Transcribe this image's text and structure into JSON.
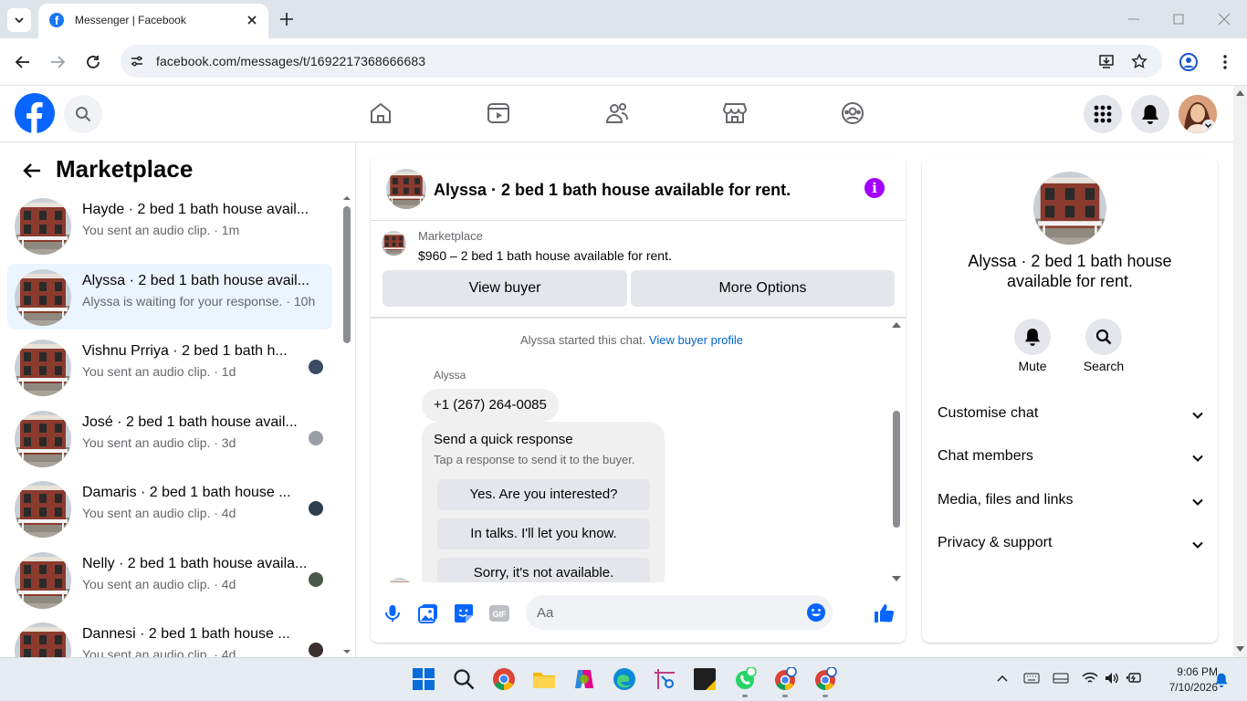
{
  "browser": {
    "tab_title": "Messenger | Facebook",
    "url": "facebook.com/messages/t/1692217368666683"
  },
  "fb_nav": {
    "icons": [
      "home-icon",
      "reels-icon",
      "friends-icon",
      "marketplace-icon",
      "groups-icon"
    ]
  },
  "sidebar": {
    "title": "Marketplace",
    "conversations": [
      {
        "title": "Hayde · 2 bed 1 bath house avail...",
        "subtitle": "You sent an audio clip. · 1m"
      },
      {
        "title": "Alyssa · 2 bed 1 bath house avail...",
        "subtitle": "Alyssa is waiting for your response. · 10h"
      },
      {
        "title": "Vishnu Prriya · 2 bed 1 bath h...",
        "subtitle": "You sent an audio clip. · 1d"
      },
      {
        "title": "José · 2 bed 1 bath house avail...",
        "subtitle": "You sent an audio clip. · 3d"
      },
      {
        "title": "Damaris · 2 bed 1 bath house ...",
        "subtitle": "You sent an audio clip. · 4d"
      },
      {
        "title": "Nelly · 2 bed 1 bath house availa...",
        "subtitle": "You sent an audio clip. · 4d"
      },
      {
        "title": "Dannesi · 2 bed 1 bath house ...",
        "subtitle": "You sent an audio clip. · 4d"
      }
    ]
  },
  "chat": {
    "title": "Alyssa · 2 bed 1 bath house available for rent.",
    "marketplace_label": "Marketplace",
    "listing": "$960 – 2 bed 1 bath house available for rent.",
    "view_buyer": "View buyer",
    "more_options": "More Options",
    "started_text": "Alyssa started this chat.",
    "view_profile": "View buyer profile",
    "sender": "Alyssa",
    "phone": "+1 (267) 264-0085",
    "quick_title": "Send a quick response",
    "quick_sub": "Tap a response to send it to the buyer.",
    "quick_options": [
      "Yes. Are you interested?",
      "In talks. I'll let you know.",
      "Sorry, it's not available."
    ],
    "composer_placeholder": "Aa"
  },
  "details": {
    "name": "Alyssa · 2 bed 1 bath house available for rent.",
    "mute": "Mute",
    "search": "Search",
    "sections": [
      "Customise chat",
      "Chat members",
      "Media, files and links",
      "Privacy & support"
    ]
  },
  "taskbar": {
    "time": "9:06 PM",
    "date": "7/10/2026"
  },
  "colors": {
    "fb_blue": "#0866ff",
    "accent_purple": "#a200ff",
    "active_row": "#ebf5ff"
  }
}
